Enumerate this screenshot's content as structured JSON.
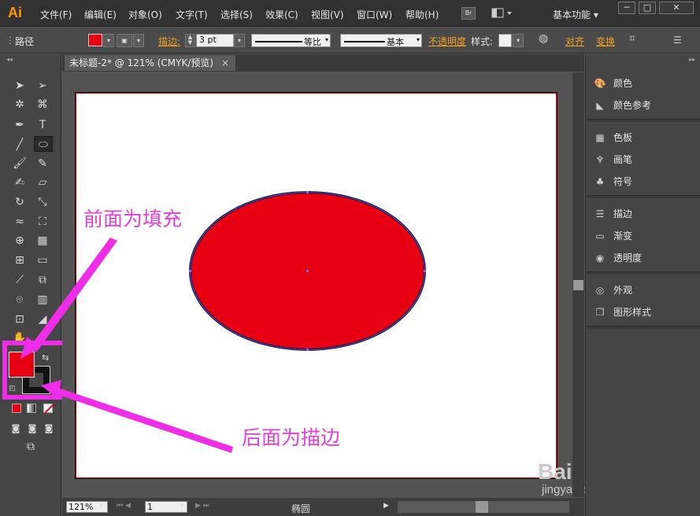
{
  "app": {
    "logo": "Ai"
  },
  "menu": [
    "文件(F)",
    "编辑(E)",
    "对象(O)",
    "文字(T)",
    "选择(S)",
    "效果(C)",
    "视图(V)",
    "窗口(W)",
    "帮助(H)"
  ],
  "menubar": {
    "bridge": "Br",
    "workspace": "基本功能",
    "win_min": "─",
    "win_max": "□",
    "win_close": "✕"
  },
  "control": {
    "object_type": "路径",
    "stroke_label": "描边:",
    "stroke_weight": "3 pt",
    "profile_label": "等比",
    "brush_label": "基本",
    "opacity_label": "不透明度",
    "style_label": "样式:",
    "align_label": "对齐",
    "transform_label": "变换"
  },
  "document": {
    "tab_title": "未标题-2* @ 121% (CMYK/预览)",
    "close": "×"
  },
  "status": {
    "zoom": "121%",
    "page": "1",
    "tool_name": "椭圆"
  },
  "panels": [
    {
      "icon": "color-icon",
      "label": "颜色"
    },
    {
      "icon": "color-guide-icon",
      "label": "颜色参考"
    },
    {
      "icon": "swatches-icon",
      "label": "色板"
    },
    {
      "icon": "brushes-icon",
      "label": "画笔"
    },
    {
      "icon": "symbols-icon",
      "label": "符号"
    },
    {
      "icon": "stroke-icon",
      "label": "描边"
    },
    {
      "icon": "gradient-icon",
      "label": "渐变"
    },
    {
      "icon": "transparency-icon",
      "label": "透明度"
    },
    {
      "icon": "appearance-icon",
      "label": "外观"
    },
    {
      "icon": "graphic-styles-icon",
      "label": "图形样式"
    }
  ],
  "annotations": {
    "fill_note": "前面为填充",
    "stroke_note": "后面为描边"
  },
  "watermark": {
    "brand": "Baidu经验",
    "url": "jingyan.baidu.com"
  },
  "colors": {
    "fill": "#e60012",
    "stroke": "#000000",
    "annotation": "#ef2ce8",
    "ellipse_stroke": "#1a1a4a"
  }
}
